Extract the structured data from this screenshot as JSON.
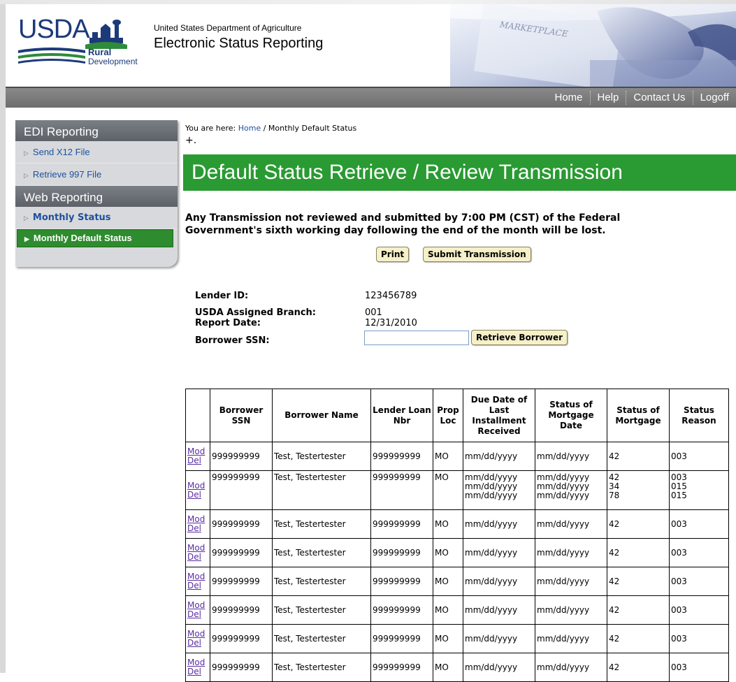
{
  "header": {
    "logo_usda": "USDA",
    "logo_rural": "Rural",
    "logo_development": "Development",
    "agency": "United States Department of Agriculture",
    "app_title": "Electronic Status Reporting",
    "photo_text": "MARKETPLACE"
  },
  "nav": [
    "Home",
    "Help",
    "Contact Us",
    "Logoff"
  ],
  "sidebar": {
    "sections": [
      {
        "title": "EDI Reporting",
        "items": [
          "Send X12 File",
          "Retrieve 997 File"
        ]
      },
      {
        "title": "Web Reporting",
        "items": [
          "Monthly Status",
          "Monthly Default Status"
        ]
      }
    ]
  },
  "breadcrumb": {
    "prefix": "You are here:",
    "home": "Home",
    "current": "/ Monthly Default Status"
  },
  "plus_mark": "+.",
  "page_title": "Default Status Retrieve / Review Transmission",
  "warning_line1": "Any Transmission not reviewed and submitted by 7:00 PM (CST) of the Federal",
  "warning_line2": "Government's sixth working day following the end of the month will be lost.",
  "buttons": {
    "print": "Print",
    "submit": "Submit Transmission",
    "retrieve": "Retrieve Borrower"
  },
  "info": {
    "lender_id_label": "Lender ID:",
    "lender_id": "123456789",
    "branch_label": "USDA Assigned Branch:",
    "branch": "001",
    "report_date_label": "Report Date:",
    "report_date": "12/31/2010",
    "ssn_label": "Borrower SSN:",
    "ssn_value": ""
  },
  "table": {
    "headers": [
      "",
      "Borrower SSN",
      "Borrower Name",
      "Lender Loan Nbr",
      "Prop Loc",
      "Due Date of Last Installment Received",
      "Status of Mortgage Date",
      "Status of Mortgage",
      "Status Reason"
    ],
    "actions": [
      "Mod",
      "Del"
    ],
    "rows": [
      {
        "ssn": "999999999",
        "name": "Test, Testertester",
        "loan": "999999999",
        "loc": "MO",
        "due": [
          "mm/dd/yyyy"
        ],
        "sdate": [
          "mm/dd/yyyy"
        ],
        "status": [
          "42"
        ],
        "reason": [
          "003"
        ]
      },
      {
        "ssn": "999999999",
        "name": "Test, Testertester",
        "loan": "999999999",
        "loc": "MO",
        "due": [
          "mm/dd/yyyy",
          "mm/dd/yyyy",
          "mm/dd/yyyy"
        ],
        "sdate": [
          "mm/dd/yyyy",
          "mm/dd/yyyy",
          "mm/dd/yyyy"
        ],
        "status": [
          "42",
          "34",
          "78"
        ],
        "reason": [
          "003",
          "015",
          "015"
        ]
      },
      {
        "ssn": "999999999",
        "name": "Test, Testertester",
        "loan": "999999999",
        "loc": "MO",
        "due": [
          "mm/dd/yyyy"
        ],
        "sdate": [
          "mm/dd/yyyy"
        ],
        "status": [
          "42"
        ],
        "reason": [
          "003"
        ]
      },
      {
        "ssn": "999999999",
        "name": "Test, Testertester",
        "loan": "999999999",
        "loc": "MO",
        "due": [
          "mm/dd/yyyy"
        ],
        "sdate": [
          "mm/dd/yyyy"
        ],
        "status": [
          "42"
        ],
        "reason": [
          "003"
        ]
      },
      {
        "ssn": "999999999",
        "name": "Test, Testertester",
        "loan": "999999999",
        "loc": "MO",
        "due": [
          "mm/dd/yyyy"
        ],
        "sdate": [
          "mm/dd/yyyy"
        ],
        "status": [
          "42"
        ],
        "reason": [
          "003"
        ]
      },
      {
        "ssn": "999999999",
        "name": "Test, Testertester",
        "loan": "999999999",
        "loc": "MO",
        "due": [
          "mm/dd/yyyy"
        ],
        "sdate": [
          "mm/dd/yyyy"
        ],
        "status": [
          "42"
        ],
        "reason": [
          "003"
        ]
      },
      {
        "ssn": "999999999",
        "name": "Test, Testertester",
        "loan": "999999999",
        "loc": "MO",
        "due": [
          "mm/dd/yyyy"
        ],
        "sdate": [
          "mm/dd/yyyy"
        ],
        "status": [
          "42"
        ],
        "reason": [
          "003"
        ]
      },
      {
        "ssn": "999999999",
        "name": "Test, Testertester",
        "loan": "999999999",
        "loc": "MO",
        "due": [
          "mm/dd/yyyy"
        ],
        "sdate": [
          "mm/dd/yyyy"
        ],
        "status": [
          "42"
        ],
        "reason": [
          "003"
        ]
      }
    ]
  },
  "colors": {
    "green": "#2a9a32",
    "nav_gray": "#7a7a7a",
    "link_blue": "#1f4f9e",
    "usda_blue": "#1c3a7a",
    "button_bg": "#f5f0c8"
  }
}
